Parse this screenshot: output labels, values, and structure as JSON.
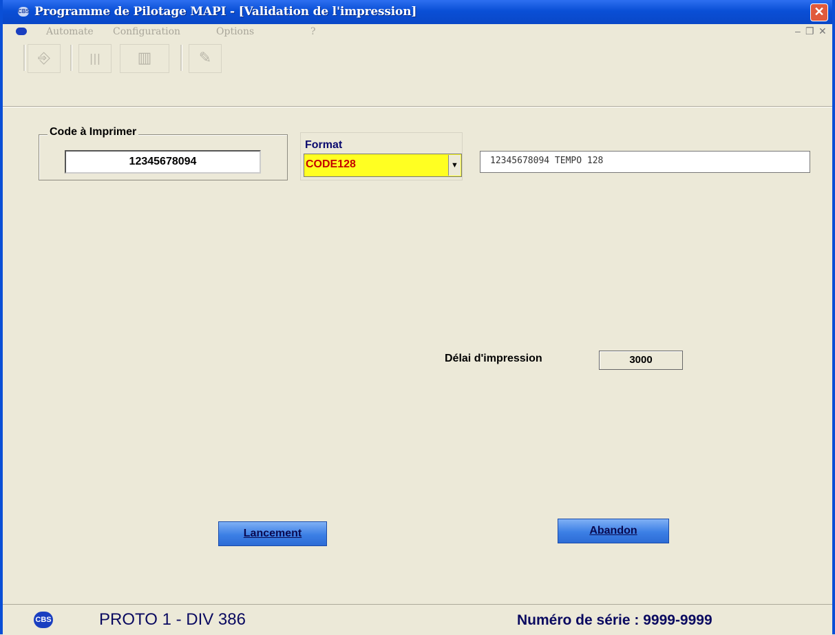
{
  "window": {
    "title": "Programme de Pilotage MAPI - [Validation de l'impression]",
    "close_glyph": "✕"
  },
  "menu": {
    "items": [
      "Automate",
      "Configuration",
      "Options",
      "?"
    ],
    "mdi_minimize": "–",
    "mdi_restore": "❐",
    "mdi_close": "✕"
  },
  "toolbar": {
    "buttons": [
      {
        "icon": "exit-door-icon",
        "glyph": "⎆"
      },
      {
        "icon": "bars-icon",
        "glyph": "|||"
      },
      {
        "icon": "barcode-icon",
        "glyph": "▥"
      },
      {
        "icon": "edit-pen-icon",
        "glyph": "✎"
      }
    ]
  },
  "code_group": {
    "label": "Code à Imprimer",
    "value": "12345678094"
  },
  "format": {
    "label": "Format",
    "selected": "CODE128",
    "dropdown_glyph": "▼"
  },
  "preview": {
    "text": "12345678094 TEMPO 128"
  },
  "delai": {
    "label": "Délai d'impression",
    "value": "3000"
  },
  "buttons": {
    "lancement": "Lancement",
    "abandon": "Abandon"
  },
  "status": {
    "logo_text": "CBS",
    "left": "PROTO 1 - DIV 386",
    "right": "Numéro de série : 9999-9999"
  },
  "colors": {
    "titlebar": "#0a4fd6",
    "window_bg": "#ece9d8",
    "format_bg": "#ffff22",
    "format_text": "#c40000",
    "button_blue": "#3c7fe5"
  }
}
